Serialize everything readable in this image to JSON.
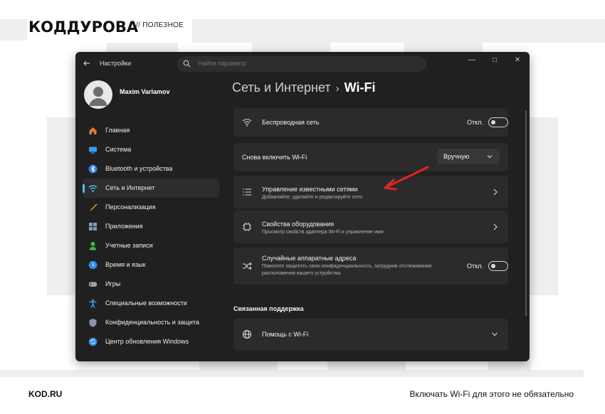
{
  "page": {
    "logo": "КОДДУРОВА",
    "logo_sub": "// ПОЛЕЗНОЕ",
    "footer_left": "KOD.RU",
    "footer_right": "Включать Wi-Fi для этого не обязательно"
  },
  "window": {
    "title": "Настройки",
    "search_placeholder": "Найти параметр",
    "controls": [
      "minimize",
      "maximize",
      "close"
    ]
  },
  "user": {
    "name": "Maxim Varlamov"
  },
  "sidebar": {
    "items": [
      {
        "label": "Главная",
        "icon": "home-icon",
        "color": "#e07b39"
      },
      {
        "label": "Система",
        "icon": "system-icon",
        "color": "#3b9cf2"
      },
      {
        "label": "Bluetooth и устройства",
        "icon": "bluetooth-icon",
        "color": "#2d7de0"
      },
      {
        "label": "Сеть и Интернет",
        "icon": "wifi-icon",
        "color": "#4cc2ff",
        "active": true
      },
      {
        "label": "Персонализация",
        "icon": "brush-icon",
        "color": "#e6a23c"
      },
      {
        "label": "Приложения",
        "icon": "apps-icon",
        "color": "#8a9bb0"
      },
      {
        "label": "Учетные записи",
        "icon": "account-icon",
        "color": "#3fb950"
      },
      {
        "label": "Время и язык",
        "icon": "globe-clock-icon",
        "color": "#2d8cf0"
      },
      {
        "label": "Игры",
        "icon": "gamepad-icon",
        "color": "#9aa4b2"
      },
      {
        "label": "Специальные возможности",
        "icon": "accessibility-icon",
        "color": "#3aa7f0"
      },
      {
        "label": "Конфиденциальность и защита",
        "icon": "shield-icon",
        "color": "#8a96a8"
      },
      {
        "label": "Центр обновления Windows",
        "icon": "update-icon",
        "color": "#2f8ff0"
      }
    ]
  },
  "breadcrumb": {
    "parent": "Сеть и Интернет",
    "separator": "›",
    "current": "Wi-Fi"
  },
  "settings": {
    "wireless": {
      "title": "Беспроводная сеть",
      "state": "Откл."
    },
    "reenable": {
      "title": "Снова включить Wi-Fi",
      "value": "Вручную"
    },
    "known_networks": {
      "title": "Управление известными сетями",
      "desc": "Добавляйте, удаляйте и редактируйте сети"
    },
    "hardware": {
      "title": "Свойства оборудования",
      "desc": "Просмотр свойств адаптера Wi-Fi и управление ими"
    },
    "random_mac": {
      "title": "Случайные аппаратные адреса",
      "desc": "Помогите защитить свою конфиденциальность, затруднив отслеживание расположения вашего устройства.",
      "state": "Откл."
    }
  },
  "support": {
    "heading": "Связанная поддержка",
    "help": {
      "title": "Помощь с Wi-Fi"
    }
  },
  "colors": {
    "accent": "#4cc2ff",
    "annotation_arrow": "#e02424"
  }
}
